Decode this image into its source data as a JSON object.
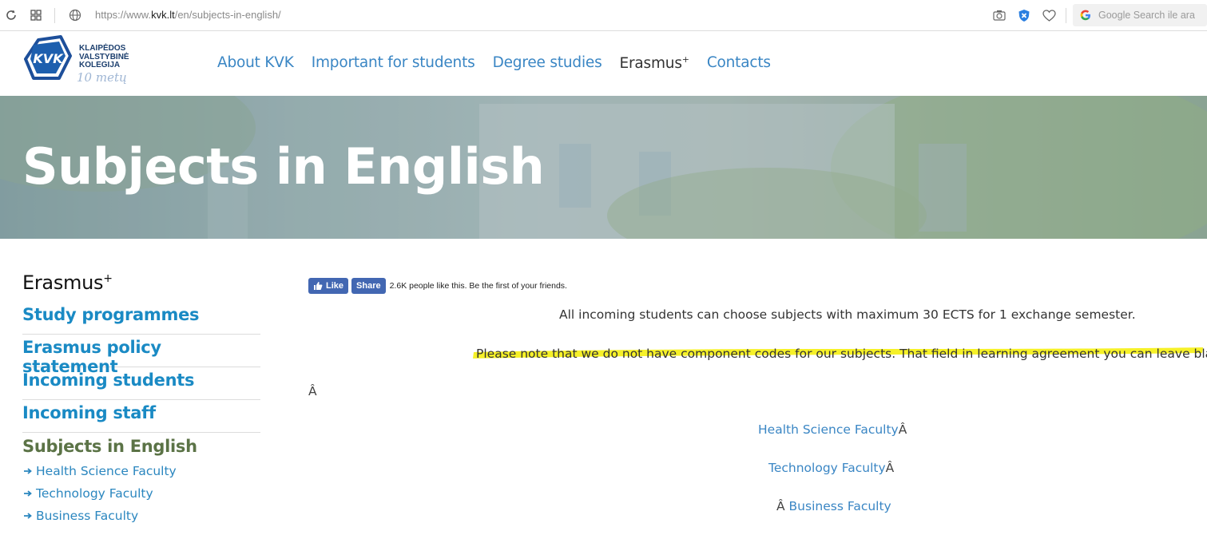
{
  "browser": {
    "url_prefix": "https://www.",
    "url_host": "kvk.lt",
    "url_path": "/en/subjects-in-english/",
    "search_placeholder": "Google Search ile ara"
  },
  "logo": {
    "lines": [
      "KLAIPĖDOS",
      "VALSTYBINĖ",
      "KOLEGIJA"
    ],
    "mark": "KVK",
    "years": "10 metų"
  },
  "nav": {
    "items": [
      {
        "label": "About KVK"
      },
      {
        "label": "Important for students"
      },
      {
        "label": "Degree studies"
      },
      {
        "label": "Erasmus",
        "sup": "+"
      },
      {
        "label": "Contacts"
      }
    ]
  },
  "hero": {
    "title": "Subjects in English"
  },
  "sidebar": {
    "heading": "Erasmus",
    "heading_sup": "+",
    "links": [
      {
        "label": "Study programmes"
      },
      {
        "label": "Erasmus policy statement"
      },
      {
        "label": "Incoming students"
      },
      {
        "label": "Incoming staff"
      }
    ],
    "current": "Subjects in English",
    "sublinks": [
      {
        "label": "Health Science Faculty"
      },
      {
        "label": "Technology Faculty"
      },
      {
        "label": "Business Faculty"
      }
    ]
  },
  "facebook": {
    "like_label": "Like",
    "share_label": "Share",
    "count_text": "2.6K people like this. Be the first of your friends."
  },
  "content": {
    "intro": "All incoming students can choose subjects with maximum 30 ECTS for 1 exchange semester.",
    "note": "Please note that we do not have component codes for our subjects. That field in learning agreement you can leave blank.",
    "stray_char": "Â",
    "faculty_health": "Health Science Faculty",
    "faculty_technology": "Technology Faculty",
    "faculty_business": "Business Faculty"
  },
  "colors": {
    "link_blue": "#3a86c4",
    "sidebar_blue": "#1a8ac4",
    "current_green": "#5b7346",
    "highlight_yellow": "#f5f01c",
    "facebook_blue": "#4267b2"
  }
}
